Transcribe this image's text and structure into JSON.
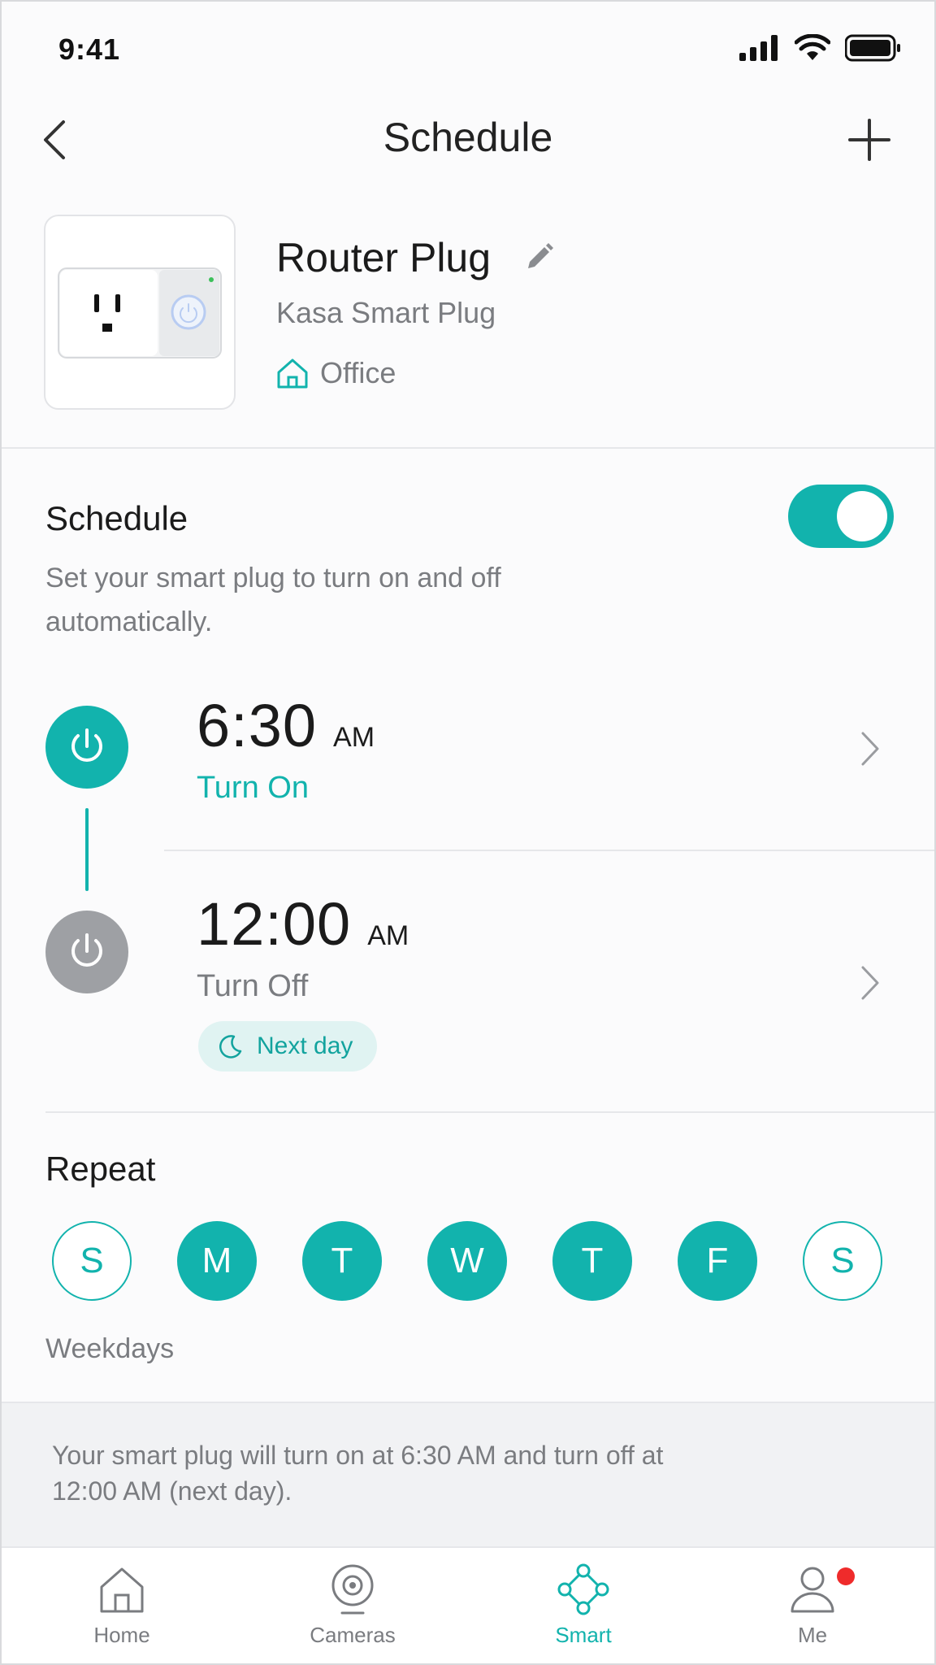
{
  "status_bar": {
    "time": "9:41"
  },
  "header": {
    "title": "Schedule"
  },
  "device": {
    "name": "Router Plug",
    "model": "Kasa Smart Plug",
    "room": "Office"
  },
  "schedule": {
    "title": "Schedule",
    "description": "Set your smart plug to turn on and off automatically.",
    "enabled": true,
    "events": [
      {
        "time": "6:30",
        "period": "AM",
        "action": "Turn On"
      },
      {
        "time": "12:00",
        "period": "AM",
        "action": "Turn Off",
        "tag": "Next day"
      }
    ]
  },
  "repeat": {
    "title": "Repeat",
    "days": [
      {
        "label": "S",
        "selected": false
      },
      {
        "label": "M",
        "selected": true
      },
      {
        "label": "T",
        "selected": true
      },
      {
        "label": "W",
        "selected": true
      },
      {
        "label": "T",
        "selected": true
      },
      {
        "label": "F",
        "selected": true
      },
      {
        "label": "S",
        "selected": false
      }
    ],
    "summary_label": "Weekdays"
  },
  "summary": {
    "text": "Your smart plug will turn on at 6:30 AM and turn off at 12:00 AM (next day)."
  },
  "tabs": [
    {
      "label": "Home",
      "icon": "home-icon",
      "active": false
    },
    {
      "label": "Cameras",
      "icon": "camera-icon",
      "active": false
    },
    {
      "label": "Smart",
      "icon": "smart-hub-icon",
      "active": true
    },
    {
      "label": "Me",
      "icon": "user-icon",
      "active": false,
      "badge": true
    }
  ],
  "colors": {
    "accent": "#12b3ad",
    "off_gray": "#9ea0a4",
    "badge_red": "#ef2b2b"
  }
}
